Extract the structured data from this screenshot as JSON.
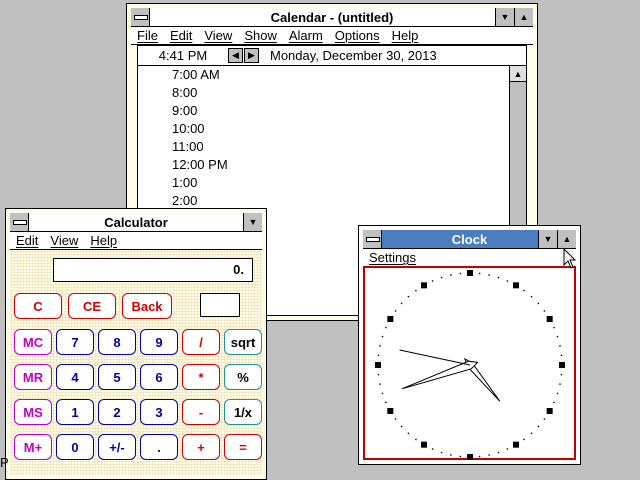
{
  "calendar": {
    "title": "Calendar - (untitled)",
    "menu": [
      "File",
      "Edit",
      "View",
      "Show",
      "Alarm",
      "Options",
      "Help"
    ],
    "current_time": "4:41 PM",
    "date": "Monday, December 30, 2013",
    "times": [
      "7:00 AM",
      "8:00",
      "9:00",
      "10:00",
      "11:00",
      "12:00 PM",
      "1:00",
      "2:00"
    ]
  },
  "calculator": {
    "title": "Calculator",
    "menu": [
      "Edit",
      "View",
      "Help"
    ],
    "display": "0.",
    "buttons": {
      "clear": "C",
      "clear_entry": "CE",
      "back": "Back",
      "mc": "MC",
      "mr": "MR",
      "ms": "MS",
      "mplus": "M+",
      "n7": "7",
      "n8": "8",
      "n9": "9",
      "div": "/",
      "sqrt": "sqrt",
      "n4": "4",
      "n5": "5",
      "n6": "6",
      "mul": "*",
      "pct": "%",
      "n1": "1",
      "n2": "2",
      "n3": "3",
      "sub": "-",
      "recip": "1/x",
      "n0": "0",
      "sign": "+/-",
      "dot": ".",
      "add": "+",
      "eq": "="
    }
  },
  "clock": {
    "title": "Clock",
    "menu": [
      "Settings"
    ],
    "time": {
      "hour": 4,
      "minute": 41,
      "second": 47
    },
    "frame_color": "#c00000"
  },
  "desktop": {
    "background": "#c0c0c0",
    "partial_label": "P"
  }
}
